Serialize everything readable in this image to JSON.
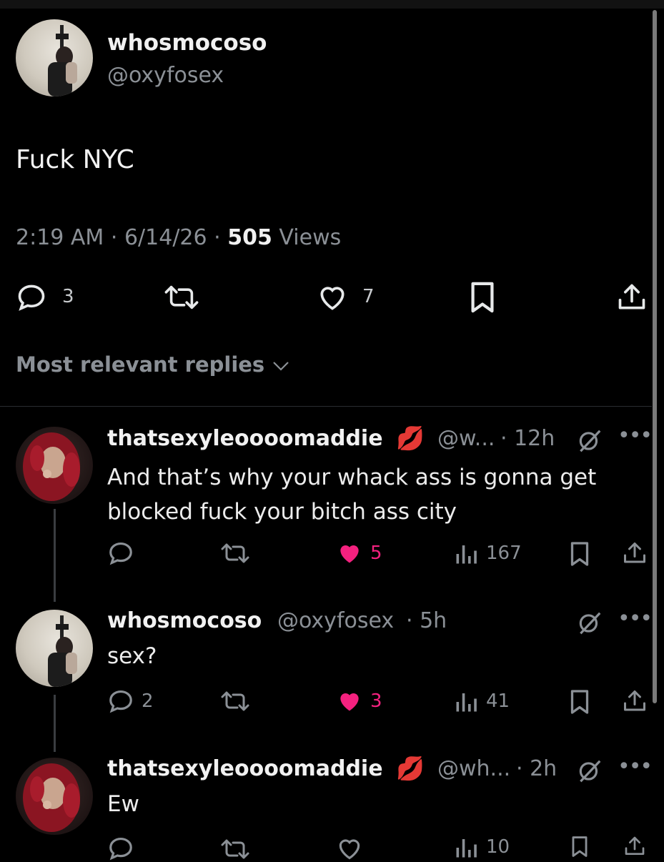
{
  "main_tweet": {
    "display_name": "whosmocoso",
    "handle": "@oxyfosex",
    "text": "Fuck NYC",
    "time": "2:19 AM",
    "sep1": "·",
    "date": "6/14/26",
    "sep2": "·",
    "views_count": "505",
    "views_label": "Views",
    "reply_count": "3",
    "like_count": "7"
  },
  "replies_filter": {
    "label": "Most relevant replies"
  },
  "replies": [
    {
      "display_name": "thatsexyleoooomaddie",
      "emoji": "💋",
      "handle": "@w...",
      "time": "· 12h",
      "text_line1": "And that’s why your whack ass is gonna get",
      "text_line2": "blocked fuck your bitch ass city",
      "like_count": "5",
      "views": "167",
      "liked": true
    },
    {
      "display_name": "whosmocoso",
      "handle": "@oxyfosex",
      "time": "· 5h",
      "text": "sex?",
      "reply_count": "2",
      "like_count": "3",
      "views": "41",
      "liked": true
    },
    {
      "display_name": "thatsexyleoooomaddie",
      "emoji": "💋",
      "handle": "@wh...",
      "time": "· 2h",
      "text": "Ew",
      "views": "10",
      "liked": false
    }
  ],
  "colors": {
    "background": "#000000",
    "muted": "#8b9096",
    "like": "#f4217f",
    "text": "#e7e9ea"
  }
}
